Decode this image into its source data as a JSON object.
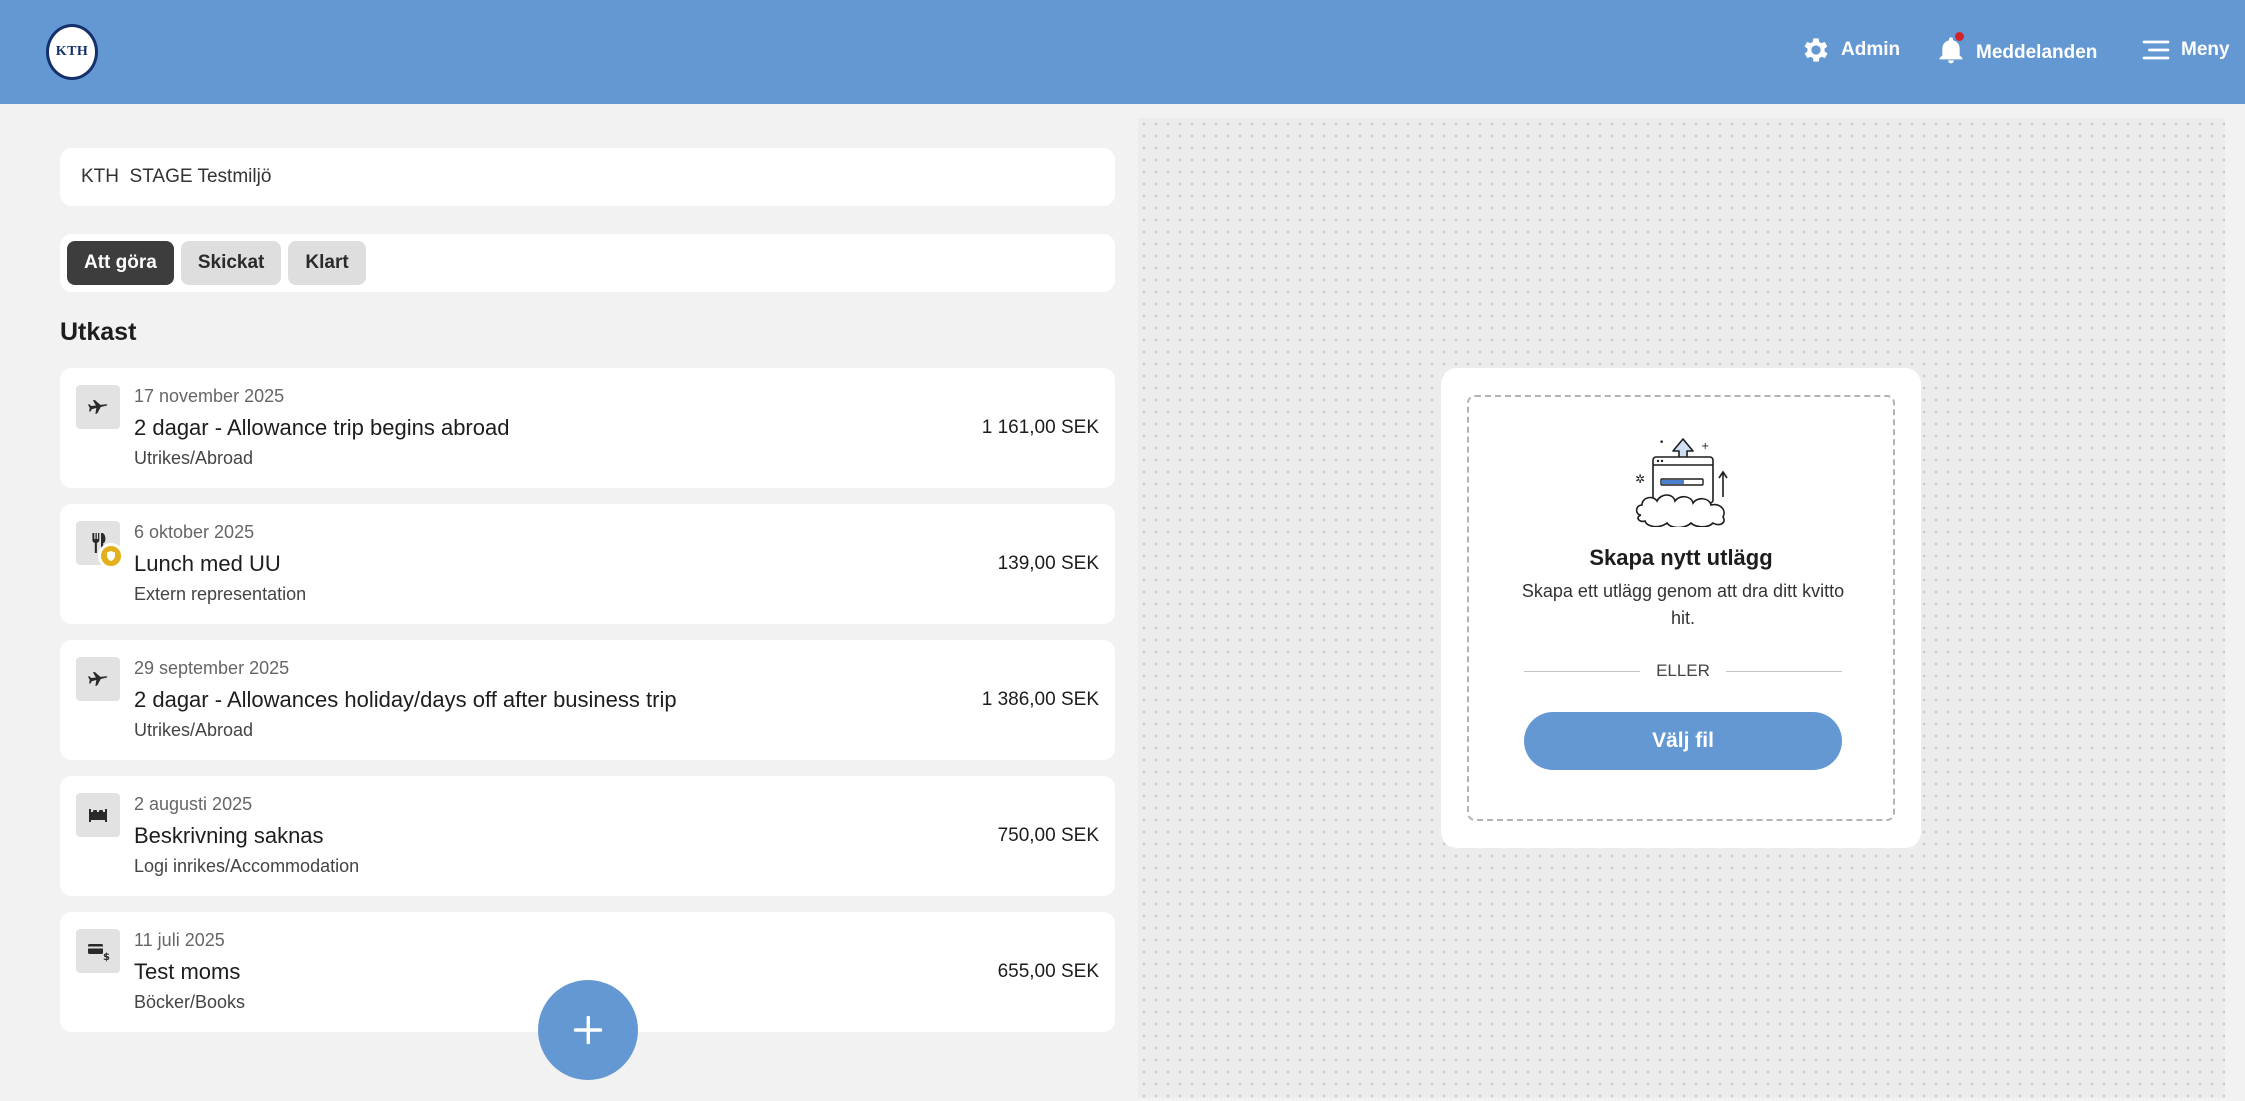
{
  "header": {
    "logo_text": "KTH",
    "admin_label": "Admin",
    "notifications_label": "Meddelanden",
    "menu_label": "Meny",
    "background_color": "#6498d2"
  },
  "environment": {
    "label": "KTH  STAGE Testmiljö"
  },
  "tabs": [
    {
      "label": "Att göra",
      "active": true
    },
    {
      "label": "Skickat",
      "active": false
    },
    {
      "label": "Klart",
      "active": false
    }
  ],
  "section_title": "Utkast",
  "expenses": [
    {
      "icon": "airplane-icon",
      "date": "17 november 2025",
      "title": "2 dagar - Allowance trip begins abroad",
      "category": "Utrikes/Abroad",
      "amount": "1 161,00 SEK"
    },
    {
      "icon": "cutlery-icon",
      "badge": "shield-badge-icon",
      "date": "6 oktober 2025",
      "title": "Lunch med UU",
      "category": "Extern representation",
      "amount": "139,00 SEK"
    },
    {
      "icon": "airplane-icon",
      "date": "29 september 2025",
      "title": "2 dagar - Allowances holiday/days off after business trip",
      "category": "Utrikes/Abroad",
      "amount": "1 386,00 SEK"
    },
    {
      "icon": "bed-icon",
      "date": "2 augusti 2025",
      "title": "Beskrivning saknas",
      "category": "Logi inrikes/Accommodation",
      "amount": "750,00 SEK"
    },
    {
      "icon": "card-dollar-icon",
      "date": "11 juli 2025",
      "title": "Test moms",
      "category": "Böcker/Books",
      "amount": "655,00 SEK"
    }
  ],
  "upload": {
    "title": "Skapa nytt utlägg",
    "description": "Skapa ett utlägg genom att dra ditt kvitto hit.",
    "or_label": "ELLER",
    "button_label": "Välj fil"
  },
  "colors": {
    "accent": "#6498d2",
    "badge": "#e2b01b",
    "notification_dot": "#d2232a"
  }
}
